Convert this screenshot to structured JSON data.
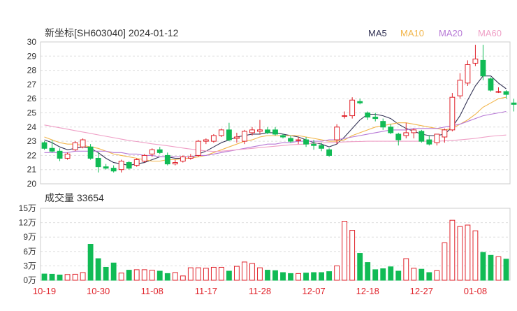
{
  "header": {
    "title": "新坐标[SH603040] 2024-01-12",
    "volume_title": "成交量 33654"
  },
  "colors": {
    "up": "#e0222a",
    "down": "#11bb55",
    "ma5": "#333355",
    "ma10": "#f2b54a",
    "ma20": "#b779d6",
    "ma60": "#ef9fc6"
  },
  "legend": [
    {
      "name": "MA5",
      "color": "#333355"
    },
    {
      "name": "MA10",
      "color": "#f2b54a"
    },
    {
      "name": "MA20",
      "color": "#b779d6"
    },
    {
      "name": "MA60",
      "color": "#ef9fc6"
    }
  ],
  "chart_data": [
    {
      "type": "candlestick",
      "title": "新坐标[SH603040] 2024-01-12",
      "ylim": [
        20,
        30
      ],
      "yticks": [
        "20",
        "21",
        "22",
        "23",
        "24",
        "25",
        "26",
        "27",
        "28",
        "29",
        "30"
      ],
      "x": [
        "10-19",
        "10-20",
        "10-23",
        "10-24",
        "10-25",
        "10-26",
        "10-27",
        "10-30",
        "10-31",
        "11-01",
        "11-02",
        "11-03",
        "11-06",
        "11-07",
        "11-08",
        "11-09",
        "11-10",
        "11-13",
        "11-14",
        "11-15",
        "11-16",
        "11-17",
        "11-20",
        "11-21",
        "11-22",
        "11-23",
        "11-24",
        "11-27",
        "11-28",
        "11-29",
        "11-30",
        "12-01",
        "12-04",
        "12-05",
        "12-06",
        "12-07",
        "12-08",
        "12-11",
        "12-12",
        "12-13",
        "12-14",
        "12-15",
        "12-18",
        "12-19",
        "12-20",
        "12-21",
        "12-22",
        "12-25",
        "12-26",
        "12-27",
        "12-28",
        "12-29",
        "01-02",
        "01-03",
        "01-04",
        "01-05",
        "01-08",
        "01-09",
        "01-10",
        "01-11",
        "01-12"
      ],
      "xticks": [
        "10-19",
        "10-30",
        "11-08",
        "11-17",
        "11-28",
        "12-07",
        "12-18",
        "12-27",
        "01-08"
      ],
      "ohlc": [
        [
          22.9,
          23.0,
          22.4,
          22.5
        ],
        [
          22.5,
          23.1,
          22.2,
          22.3
        ],
        [
          22.3,
          22.5,
          21.6,
          21.8
        ],
        [
          21.8,
          22.2,
          21.7,
          22.1
        ],
        [
          22.4,
          23.0,
          22.3,
          22.9
        ],
        [
          22.6,
          23.2,
          22.5,
          23.1
        ],
        [
          22.6,
          22.8,
          21.7,
          21.8
        ],
        [
          21.8,
          22.2,
          20.8,
          21.2
        ],
        [
          21.2,
          21.4,
          21.0,
          21.1
        ],
        [
          21.1,
          21.3,
          20.8,
          20.9
        ],
        [
          21.0,
          21.7,
          20.8,
          21.6
        ],
        [
          21.5,
          21.6,
          21.0,
          21.1
        ],
        [
          21.3,
          21.8,
          21.2,
          21.7
        ],
        [
          21.6,
          22.1,
          21.5,
          22.0
        ],
        [
          22.1,
          22.5,
          21.9,
          22.4
        ],
        [
          22.4,
          22.6,
          22.1,
          22.2
        ],
        [
          22.0,
          22.2,
          21.3,
          21.4
        ],
        [
          21.4,
          21.7,
          21.3,
          21.5
        ],
        [
          21.6,
          22.0,
          21.5,
          21.9
        ],
        [
          21.8,
          22.1,
          21.7,
          21.9
        ],
        [
          22.0,
          23.1,
          21.9,
          23.0
        ],
        [
          23.0,
          23.2,
          22.8,
          23.1
        ],
        [
          23.0,
          23.5,
          22.9,
          23.4
        ],
        [
          23.4,
          23.9,
          23.3,
          23.8
        ],
        [
          23.8,
          24.3,
          23.0,
          23.1
        ],
        [
          23.2,
          23.6,
          22.9,
          23.3
        ],
        [
          23.0,
          23.8,
          22.8,
          23.7
        ],
        [
          23.6,
          24.0,
          23.4,
          23.8
        ],
        [
          23.7,
          24.5,
          23.5,
          23.8
        ],
        [
          23.8,
          24.0,
          23.5,
          23.6
        ],
        [
          23.8,
          24.0,
          23.4,
          23.5
        ],
        [
          23.4,
          23.5,
          23.2,
          23.3
        ],
        [
          23.2,
          23.4,
          22.9,
          23.0
        ],
        [
          23.1,
          23.3,
          22.8,
          23.1
        ],
        [
          23.1,
          23.3,
          22.6,
          22.8
        ],
        [
          22.8,
          23.1,
          22.4,
          22.7
        ],
        [
          22.7,
          22.9,
          22.3,
          22.5
        ],
        [
          22.4,
          22.5,
          21.9,
          22.0
        ],
        [
          23.1,
          24.2,
          22.8,
          24.0
        ],
        [
          24.8,
          25.1,
          24.6,
          24.8
        ],
        [
          24.8,
          26.1,
          24.6,
          25.9
        ],
        [
          25.8,
          26.0,
          25.6,
          25.7
        ],
        [
          25.0,
          25.1,
          24.5,
          24.7
        ],
        [
          24.7,
          25.0,
          24.4,
          24.6
        ],
        [
          24.4,
          24.6,
          23.8,
          24.0
        ],
        [
          24.0,
          24.2,
          23.5,
          23.6
        ],
        [
          23.5,
          23.6,
          22.7,
          23.1
        ],
        [
          23.4,
          24.3,
          23.2,
          23.6
        ],
        [
          23.6,
          23.9,
          23.2,
          23.8
        ],
        [
          23.7,
          23.8,
          22.9,
          23.0
        ],
        [
          23.1,
          23.4,
          22.7,
          22.8
        ],
        [
          22.9,
          23.5,
          22.7,
          23.5
        ],
        [
          23.3,
          23.9,
          22.9,
          23.8
        ],
        [
          23.8,
          26.4,
          23.7,
          26.1
        ],
        [
          26.2,
          27.8,
          26.0,
          27.3
        ],
        [
          27.1,
          28.7,
          26.9,
          28.4
        ],
        [
          28.5,
          29.8,
          28.3,
          28.8
        ],
        [
          28.7,
          29.8,
          27.3,
          27.6
        ],
        [
          27.4,
          27.5,
          26.5,
          26.6
        ],
        [
          26.5,
          26.8,
          26.4,
          26.5
        ],
        [
          26.5,
          26.6,
          26.0,
          26.3
        ],
        [
          25.7,
          26.0,
          25.1,
          25.6
        ]
      ],
      "series": [
        {
          "name": "MA5",
          "values": [
            23.1,
            22.9,
            22.6,
            22.4,
            22.5,
            22.6,
            22.5,
            22.2,
            21.8,
            21.5,
            21.4,
            21.3,
            21.4,
            21.5,
            21.7,
            21.9,
            21.9,
            21.8,
            21.8,
            21.8,
            22.1,
            22.3,
            22.6,
            22.9,
            23.1,
            23.3,
            23.4,
            23.5,
            23.5,
            23.6,
            23.6,
            23.5,
            23.4,
            23.3,
            23.1,
            22.9,
            22.8,
            22.6,
            22.8,
            23.3,
            23.9,
            24.5,
            24.9,
            24.9,
            24.8,
            24.6,
            24.2,
            23.9,
            23.7,
            23.5,
            23.4,
            23.4,
            23.5,
            24.0,
            24.8,
            25.9,
            26.9,
            27.6,
            27.6,
            27.1,
            26.7,
            26.4
          ]
        },
        {
          "name": "MA10",
          "values": [
            23.3,
            23.1,
            22.9,
            22.8,
            22.8,
            22.7,
            22.6,
            22.5,
            22.3,
            22.1,
            22.0,
            21.9,
            21.8,
            21.7,
            21.6,
            21.6,
            21.7,
            21.7,
            21.8,
            21.8,
            21.9,
            22.0,
            22.2,
            22.4,
            22.6,
            22.8,
            23.0,
            23.1,
            23.3,
            23.4,
            23.4,
            23.4,
            23.4,
            23.4,
            23.3,
            23.2,
            23.1,
            23.0,
            23.0,
            23.1,
            23.4,
            23.6,
            23.8,
            24.0,
            24.1,
            24.2,
            24.3,
            24.3,
            24.2,
            24.1,
            24.0,
            23.9,
            23.8,
            23.9,
            24.2,
            24.5,
            24.9,
            25.4,
            25.7,
            26.0,
            26.1,
            26.4
          ]
        },
        {
          "name": "MA20",
          "values": [
            22.2,
            22.2,
            22.2,
            22.2,
            22.3,
            22.3,
            22.3,
            22.3,
            22.3,
            22.2,
            22.2,
            22.1,
            22.1,
            22.0,
            22.0,
            21.9,
            21.9,
            21.9,
            21.9,
            21.9,
            22.0,
            22.0,
            22.1,
            22.2,
            22.3,
            22.4,
            22.5,
            22.6,
            22.7,
            22.8,
            22.8,
            22.9,
            22.9,
            23.0,
            23.0,
            23.0,
            23.0,
            23.1,
            23.1,
            23.2,
            23.3,
            23.4,
            23.5,
            23.6,
            23.7,
            23.8,
            23.8,
            23.8,
            23.9,
            23.9,
            23.9,
            23.9,
            24.0,
            24.1,
            24.2,
            24.4,
            24.6,
            24.8,
            24.9,
            25.0,
            25.1,
            25.1
          ]
        },
        {
          "name": "MA60",
          "values": [
            24.15,
            24.05,
            23.95,
            23.85,
            23.75,
            23.65,
            23.55,
            23.45,
            23.35,
            23.25,
            23.15,
            23.05,
            22.98,
            22.9,
            22.82,
            22.75,
            22.68,
            22.6,
            22.52,
            22.45,
            22.38,
            22.32,
            22.28,
            22.3,
            22.35,
            22.4,
            22.45,
            22.5,
            22.55,
            22.6,
            22.65,
            22.7,
            22.75,
            22.78,
            22.8,
            22.85,
            22.88,
            22.9,
            22.92,
            22.95,
            22.97,
            22.98,
            23.0,
            23.0,
            23.0,
            23.0,
            23.0,
            23.0,
            23.0,
            23.0,
            23.0,
            23.0,
            23.03,
            23.06,
            23.1,
            23.15,
            23.2,
            23.28,
            23.35,
            23.4,
            23.44,
            23.47
          ]
        }
      ]
    },
    {
      "type": "bar",
      "title": "成交量 33654",
      "ylim": [
        0,
        150000
      ],
      "yticks": [
        "0万",
        "3万",
        "6万",
        "9万",
        "12万",
        "15万"
      ],
      "values": [
        13000,
        12500,
        11000,
        12000,
        12500,
        16000,
        75000,
        45000,
        27000,
        36000,
        15000,
        21000,
        22000,
        22000,
        21000,
        19000,
        14000,
        16000,
        9000,
        26000,
        26000,
        25000,
        27000,
        27000,
        19000,
        29000,
        38000,
        35000,
        26000,
        21000,
        20000,
        16000,
        14000,
        14000,
        15000,
        16000,
        16000,
        18000,
        30000,
        123000,
        104000,
        56000,
        37000,
        22000,
        24000,
        28000,
        19000,
        45000,
        25000,
        23000,
        16000,
        20000,
        78000,
        125000,
        112000,
        115000,
        103000,
        58000,
        52000,
        49000,
        44000,
        36000
      ]
    }
  ]
}
